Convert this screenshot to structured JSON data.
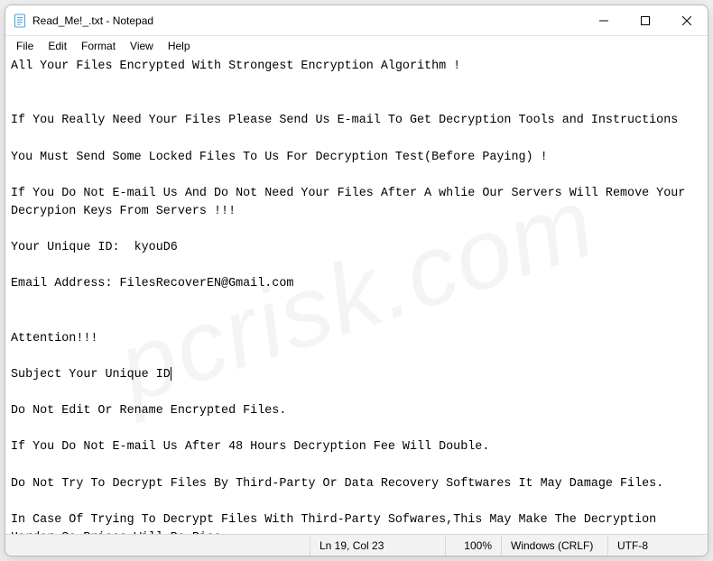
{
  "window": {
    "title": "Read_Me!_.txt - Notepad"
  },
  "menus": {
    "file": "File",
    "edit": "Edit",
    "format": "Format",
    "view": "View",
    "help": "Help"
  },
  "body_text": "All Your Files Encrypted With Strongest Encryption Algorithm !\n\n\nIf You Really Need Your Files Please Send Us E-mail To Get Decryption Tools and Instructions\n\nYou Must Send Some Locked Files To Us For Decryption Test(Before Paying) !\n\nIf You Do Not E-mail Us And Do Not Need Your Files After A whlie Our Servers Will Remove Your Decrypion Keys From Servers !!!\n\nYour Unique ID:  kyouD6\n\nEmail Address: FilesRecoverEN@Gmail.com\n\n\nAttention!!!\n\nSubject Your Unique ID",
  "body_text_after": "\n\nDo Not Edit Or Rename Encrypted Files.\n\nIf You Do Not E-mail Us After 48 Hours Decryption Fee Will Double.\n\nDo Not Try To Decrypt Files By Third-Party Or Data Recovery Softwares It May Damage Files.\n\nIn Case Of Trying To Decrypt Files With Third-Party Sofwares,This May Make The Decryption Harder So Prices Will Be Rise.",
  "status": {
    "position": "Ln 19, Col 23",
    "zoom": "100%",
    "line_ending": "Windows (CRLF)",
    "encoding": "UTF-8"
  },
  "watermark": "pcrisk.com"
}
